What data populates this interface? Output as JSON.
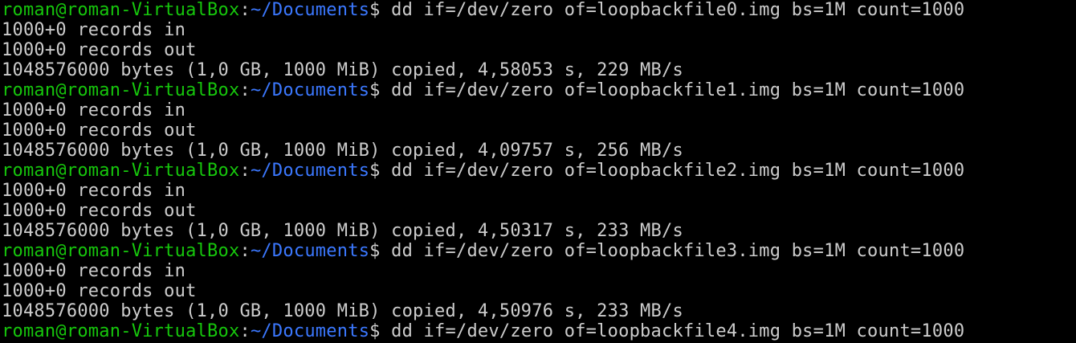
{
  "terminal": {
    "prompt": {
      "user_host": "roman@roman-VirtualBox",
      "separator": ":",
      "path": "~/Documents",
      "symbol": "$ "
    },
    "lines": [
      {
        "type": "prompt",
        "command": "dd if=/dev/zero of=loopbackfile0.img bs=1M count=1000"
      },
      {
        "type": "output",
        "text": "1000+0 records in"
      },
      {
        "type": "output",
        "text": "1000+0 records out"
      },
      {
        "type": "output",
        "text": "1048576000 bytes (1,0 GB, 1000 MiB) copied, 4,58053 s, 229 MB/s"
      },
      {
        "type": "prompt",
        "command": "dd if=/dev/zero of=loopbackfile1.img bs=1M count=1000"
      },
      {
        "type": "output",
        "text": "1000+0 records in"
      },
      {
        "type": "output",
        "text": "1000+0 records out"
      },
      {
        "type": "output",
        "text": "1048576000 bytes (1,0 GB, 1000 MiB) copied, 4,09757 s, 256 MB/s"
      },
      {
        "type": "prompt",
        "command": "dd if=/dev/zero of=loopbackfile2.img bs=1M count=1000"
      },
      {
        "type": "output",
        "text": "1000+0 records in"
      },
      {
        "type": "output",
        "text": "1000+0 records out"
      },
      {
        "type": "output",
        "text": "1048576000 bytes (1,0 GB, 1000 MiB) copied, 4,50317 s, 233 MB/s"
      },
      {
        "type": "prompt",
        "command": "dd if=/dev/zero of=loopbackfile3.img bs=1M count=1000"
      },
      {
        "type": "output",
        "text": "1000+0 records in"
      },
      {
        "type": "output",
        "text": "1000+0 records out"
      },
      {
        "type": "output",
        "text": "1048576000 bytes (1,0 GB, 1000 MiB) copied, 4,50976 s, 233 MB/s"
      },
      {
        "type": "prompt",
        "command": "dd if=/dev/zero of=loopbackfile4.img bs=1M count=1000"
      }
    ]
  },
  "colors": {
    "background": "#000000",
    "user_host": "#16c60c",
    "path": "#3b78ff",
    "text": "#cccccc"
  }
}
